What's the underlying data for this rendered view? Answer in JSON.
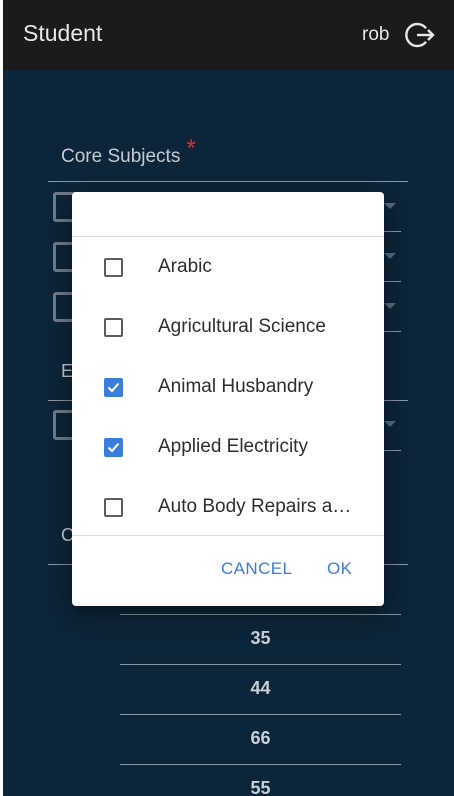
{
  "header": {
    "title": "Student",
    "user": "rob",
    "logout_icon": "logout-icon"
  },
  "core_subjects": {
    "label": "Core Subjects",
    "required_mark": "*"
  },
  "elective_label_partial": "E",
  "other_label_partial": "C",
  "dialog": {
    "options": [
      {
        "label": "Arabic",
        "checked": false
      },
      {
        "label": "Agricultural Science",
        "checked": false
      },
      {
        "label": "Animal Husbandry",
        "checked": true
      },
      {
        "label": "Applied Electricity",
        "checked": true
      },
      {
        "label": "Auto Body Repairs and Spray Painting",
        "checked": false
      }
    ],
    "cancel_label": "CANCEL",
    "ok_label": "OK"
  },
  "scores": [
    "35",
    "44",
    "66",
    "55"
  ],
  "colors": {
    "accent": "#3b7ddd",
    "required": "#e2312d",
    "background": "#0d2538",
    "appbar": "#1b1b1b"
  }
}
